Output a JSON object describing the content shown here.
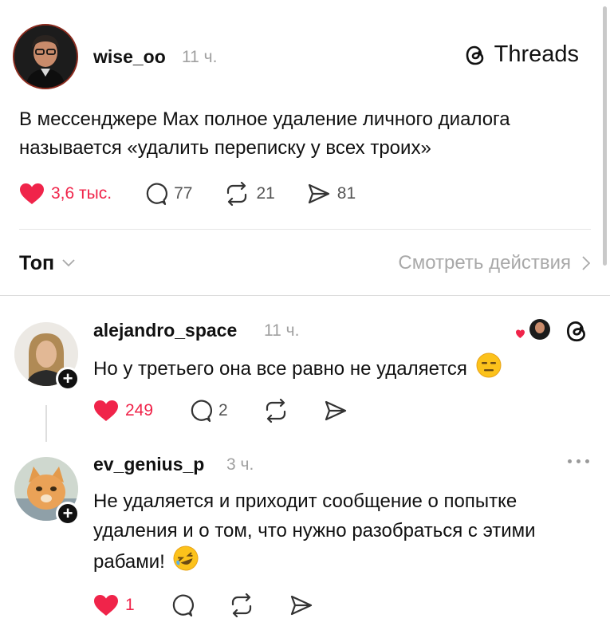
{
  "post": {
    "author": "wise_oo",
    "time": "11 ч.",
    "brand": "Threads",
    "text": "В мессенджере Max полное удаление личного диалога называется «удалить переписку у всех троих»",
    "likes": "3,6 тыс.",
    "replies": "77",
    "reposts": "21",
    "shares": "81"
  },
  "sort": {
    "label": "Топ",
    "activity_link": "Смотреть действия"
  },
  "comments": [
    {
      "author": "alejandro_space",
      "time": "11 ч.",
      "text": "Но у третьего она все равно не удаляется",
      "likes": "249",
      "replies": "2"
    },
    {
      "author": "ev_genius_p",
      "time": "3 ч.",
      "text": "Не удаляется и приходит сообщение о попытке удаления и о том, что нужно разобраться с этими рабами!",
      "likes": "1"
    }
  ],
  "icons": {
    "like": "heart-icon",
    "reply": "comment-icon",
    "repost": "repost-icon",
    "share": "share-icon",
    "brand": "threads-logo-icon",
    "expand": "chevron-down-icon",
    "next": "chevron-right-icon",
    "more": "more-icon"
  },
  "colors": {
    "like": "#f0244a",
    "muted": "#a0a0a0",
    "text": "#111111"
  }
}
